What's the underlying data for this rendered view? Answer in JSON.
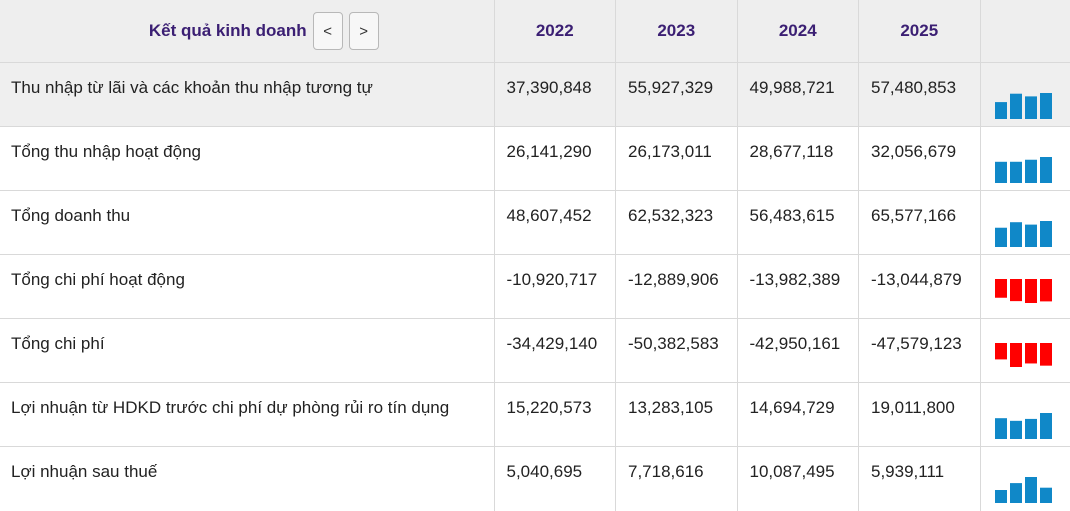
{
  "header": {
    "title": "Kết quả kinh doanh",
    "prev_label": "<",
    "next_label": ">",
    "years": [
      "2022",
      "2023",
      "2024",
      "2025"
    ]
  },
  "colors": {
    "header_text": "#3b1f73",
    "positive_bar": "#1088c8",
    "negative_bar": "#ff0000"
  },
  "rows": [
    {
      "label": "Thu nhập từ lãi và các khoản thu nhập tương tự",
      "values": [
        "37,390,848",
        "55,927,329",
        "49,988,721",
        "57,480,853"
      ],
      "series": [
        37390848,
        55927329,
        49988721,
        57480853
      ]
    },
    {
      "label": "Tổng thu nhập hoạt động",
      "values": [
        "26,141,290",
        "26,173,011",
        "28,677,118",
        "32,056,679"
      ],
      "series": [
        26141290,
        26173011,
        28677118,
        32056679
      ]
    },
    {
      "label": "Tổng doanh thu",
      "values": [
        "48,607,452",
        "62,532,323",
        "56,483,615",
        "65,577,166"
      ],
      "series": [
        48607452,
        62532323,
        56483615,
        65577166
      ]
    },
    {
      "label": "Tổng chi phí hoạt động",
      "values": [
        "-10,920,717",
        "-12,889,906",
        "-13,982,389",
        "-13,044,879"
      ],
      "series": [
        -10920717,
        -12889906,
        -13982389,
        -13044879
      ]
    },
    {
      "label": "Tổng chi phí",
      "values": [
        "-34,429,140",
        "-50,382,583",
        "-42,950,161",
        "-47,579,123"
      ],
      "series": [
        -34429140,
        -50382583,
        -42950161,
        -47579123
      ]
    },
    {
      "label": "Lợi nhuận từ HDKD trước chi phí dự phòng rủi ro tín dụng",
      "values": [
        "15,220,573",
        "13,283,105",
        "14,694,729",
        "19,011,800"
      ],
      "series": [
        15220573,
        13283105,
        14694729,
        19011800
      ]
    },
    {
      "label": "Lợi nhuận sau thuế",
      "values": [
        "5,040,695",
        "7,718,616",
        "10,087,495",
        "5,939,111"
      ],
      "series": [
        5040695,
        7718616,
        10087495,
        5939111
      ]
    }
  ]
}
